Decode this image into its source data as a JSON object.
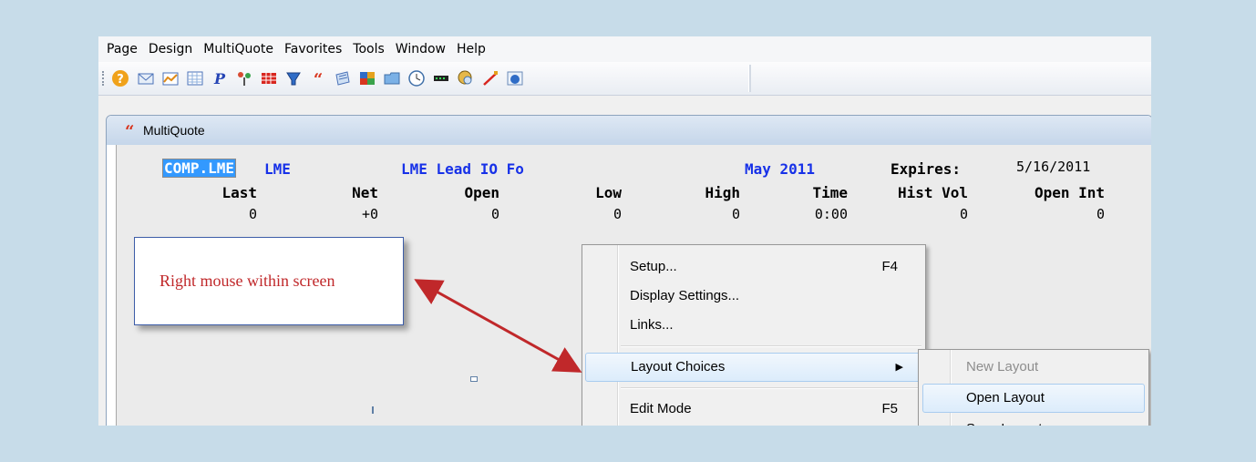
{
  "menubar": [
    "Page",
    "Design",
    "MultiQuote",
    "Favorites",
    "Tools",
    "Window",
    "Help"
  ],
  "toolbar": {
    "icons": [
      "help-icon",
      "mail-icon",
      "chart-icon",
      "grid-icon",
      "p-icon",
      "tree-icon",
      "table-icon",
      "filter-icon",
      "quote-icon",
      "news-icon",
      "heatmap-icon",
      "folder-icon",
      "clock-icon",
      "ticker-icon",
      "globe-search-icon",
      "line-tool-icon",
      "refresh-globe-icon"
    ]
  },
  "multiquote": {
    "title": "MultiQuote",
    "symbol": "COMP.LME",
    "exchange": "LME",
    "description": "LME Lead IO Fo",
    "month": "May 2011",
    "expires_label": "Expires:",
    "expires_value": "5/16/2011",
    "headers": [
      "Last",
      "Net",
      "Open",
      "Low",
      "High",
      "Time",
      "Hist Vol",
      "Open Int"
    ],
    "values": [
      "0",
      "+0",
      "0",
      "0",
      "0",
      "0:00",
      "0",
      "0"
    ]
  },
  "callout": {
    "text": "Right mouse within screen"
  },
  "context_menu": {
    "items": [
      {
        "label": "Setup...",
        "shortcut": "F4"
      },
      {
        "label": "Display Settings...",
        "shortcut": ""
      },
      {
        "label": "Links...",
        "shortcut": ""
      },
      {
        "label": "Layout Choices",
        "shortcut": ""
      },
      {
        "label": "Edit Mode",
        "shortcut": "F5"
      }
    ]
  },
  "submenu": {
    "items": [
      {
        "label": "New Layout"
      },
      {
        "label": "Open Layout"
      },
      {
        "label": "Save Layout"
      }
    ]
  },
  "colors": {
    "page_bg": "#c7dce9",
    "quote_blue": "#1731e8",
    "callout_text": "#c0282a",
    "arrow": "#c0282a"
  }
}
